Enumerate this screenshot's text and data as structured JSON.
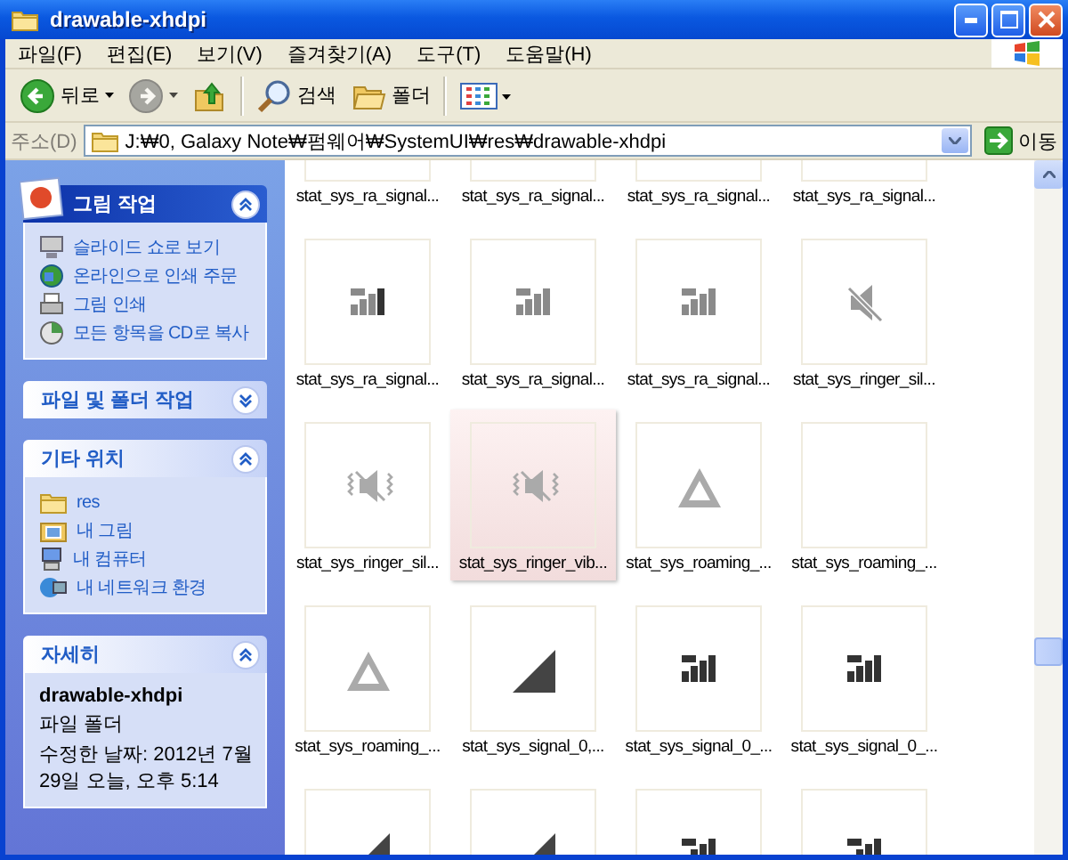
{
  "window": {
    "title": "drawable-xhdpi"
  },
  "menu": [
    {
      "label": "파일(F)"
    },
    {
      "label": "편집(E)"
    },
    {
      "label": "보기(V)"
    },
    {
      "label": "즐겨찾기(A)"
    },
    {
      "label": "도구(T)"
    },
    {
      "label": "도움말(H)"
    }
  ],
  "toolbar": [
    {
      "kind": "back",
      "label": "뒤로",
      "disabled": false
    },
    {
      "kind": "forward",
      "disabled": true
    },
    {
      "kind": "up"
    },
    {
      "kind": "search",
      "label": "검색"
    },
    {
      "kind": "folders",
      "label": "폴더"
    },
    {
      "kind": "views"
    }
  ],
  "address": {
    "label": "주소(D)",
    "value": "J:₩0, Galaxy Note₩펌웨어₩SystemUI₩res₩drawable-xhdpi",
    "go": "이동"
  },
  "sidebar": [
    {
      "title": "그림 작업",
      "kind": "special",
      "expanded": true,
      "items": [
        "슬라이드 쇼로 보기",
        "온라인으로 인쇄 주문",
        "그림 인쇄",
        "모든 항목을 CD로 복사"
      ]
    },
    {
      "title": "파일 및 폴더 작업",
      "kind": "normal",
      "expanded": false
    },
    {
      "title": "기타 위치",
      "kind": "normal",
      "expanded": true,
      "items": [
        "res",
        "내 그림",
        "내 컴퓨터",
        "내 네트워크 환경"
      ]
    },
    {
      "title": "자세히",
      "kind": "details",
      "expanded": true,
      "name": "drawable-xhdpi",
      "type": "파일 폴더",
      "modified": "수정한 날짜: 2012년 7월 29일 오늘, 오후 5:14"
    }
  ],
  "files": [
    {
      "label": "stat_sys_ra_signal...",
      "kind": "empty",
      "selected": false
    },
    {
      "label": "stat_sys_ra_signal...",
      "kind": "empty",
      "selected": false
    },
    {
      "label": "stat_sys_ra_signal...",
      "kind": "empty",
      "selected": false
    },
    {
      "label": "stat_sys_ra_signal...",
      "kind": "empty",
      "selected": false
    },
    {
      "label": "stat_sys_ra_signal...",
      "kind": "signal-mixed",
      "selected": false
    },
    {
      "label": "stat_sys_ra_signal...",
      "kind": "signal-grey",
      "selected": false
    },
    {
      "label": "stat_sys_ra_signal...",
      "kind": "signal-grey",
      "selected": false
    },
    {
      "label": "stat_sys_ringer_sil...",
      "kind": "speaker-muted",
      "selected": false
    },
    {
      "label": "stat_sys_ringer_sil...",
      "kind": "vibrate",
      "selected": false
    },
    {
      "label": "stat_sys_ringer_vib...",
      "kind": "vibrate",
      "selected": true
    },
    {
      "label": "stat_sys_roaming_...",
      "kind": "triangle",
      "selected": false
    },
    {
      "label": "stat_sys_roaming_...",
      "kind": "empty",
      "selected": false
    },
    {
      "label": "stat_sys_roaming_...",
      "kind": "triangle",
      "selected": false
    },
    {
      "label": "stat_sys_signal_0,...",
      "kind": "wedge",
      "selected": false
    },
    {
      "label": "stat_sys_signal_0_...",
      "kind": "signal-dark",
      "selected": false
    },
    {
      "label": "stat_sys_signal_0_...",
      "kind": "signal-dark",
      "selected": false
    },
    {
      "kind": "wedge",
      "selected": false
    },
    {
      "kind": "wedge",
      "selected": false
    },
    {
      "kind": "signal-dark",
      "selected": false
    },
    {
      "kind": "signal-dark",
      "selected": false
    }
  ]
}
